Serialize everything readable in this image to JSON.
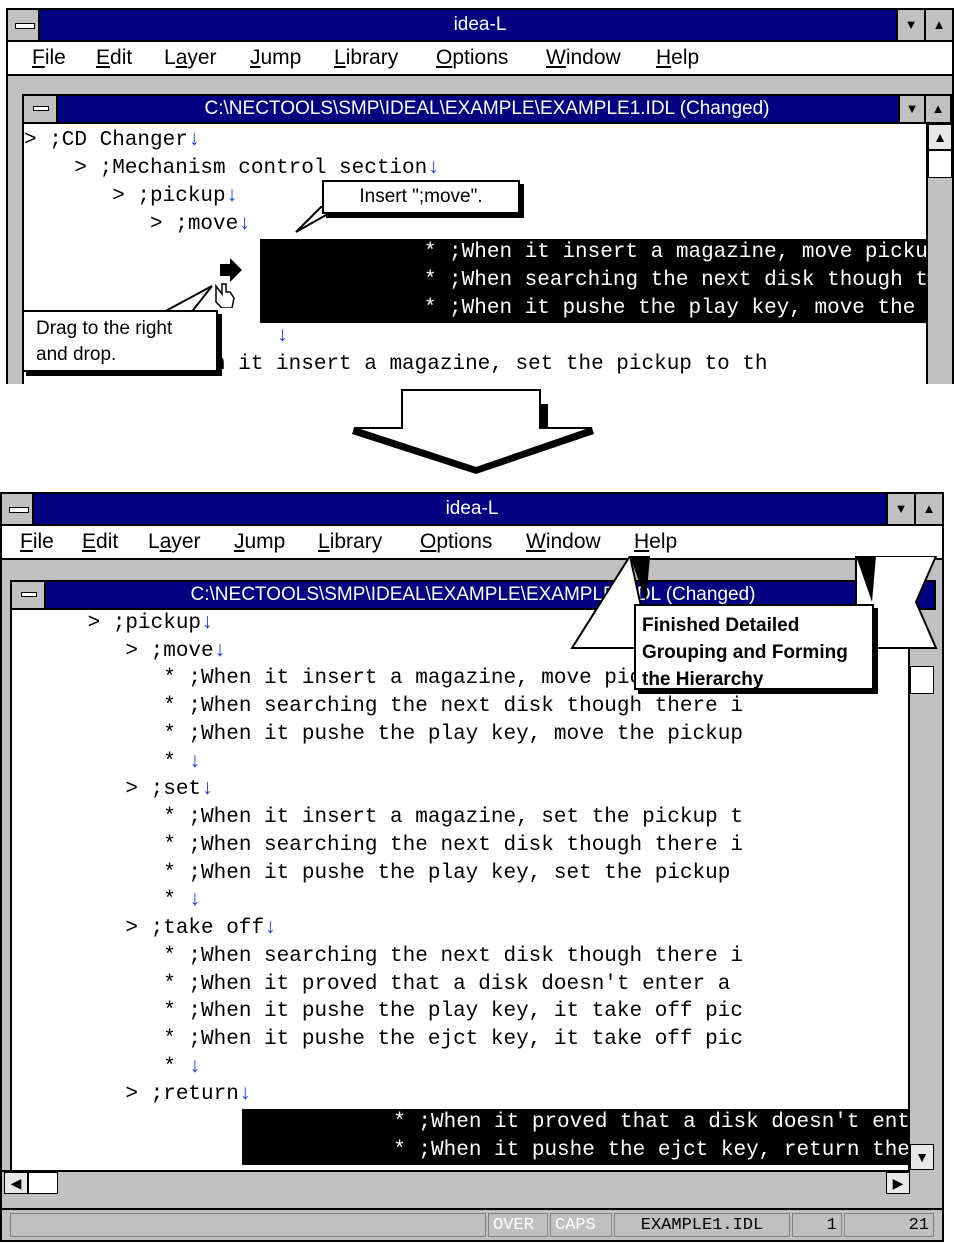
{
  "top": {
    "app_title": "idea-L",
    "menu": [
      "File",
      "Edit",
      "Layer",
      "Jump",
      "Library",
      "Options",
      "Window",
      "Help"
    ],
    "doc_title": "C:\\NECTOOLS\\SMP\\IDEAL\\EXAMPLE\\EXAMPLE1.IDL (Changed)",
    "lines": [
      "> ;CD Changer",
      "    > ;Mechanism control section",
      "       > ;pickup",
      "          > ;move",
      "             * ;When it insert a magazine, move pickup to p",
      "             * ;When searching the next disk though there i",
      "             * ;When it pushe the play key, move the pickup",
      "           ;When it insert a magazine, set the pickup to th"
    ],
    "callout_insert": "Insert \";move\".",
    "callout_drag_1": "Drag to the right",
    "callout_drag_2": "and drop."
  },
  "bottom": {
    "app_title": "idea-L",
    "menu": [
      "File",
      "Edit",
      "Layer",
      "Jump",
      "Library",
      "Options",
      "Window",
      "Help"
    ],
    "doc_title": "C:\\NECTOOLS\\SMP\\IDEAL\\EXAMPLE\\EXAMPLE1.IDL (Changed)",
    "lines": [
      "      > ;pickup",
      "         > ;move",
      "            * ;When it insert a magazine, move pickup to p",
      "            * ;When searching the next disk though there i",
      "            * ;When it pushe the play key, move the pickup",
      "            * ",
      "         > ;set",
      "            * ;When it insert a magazine, set the pickup t",
      "            * ;When searching the next disk though there i",
      "            * ;When it pushe the play key, set the pickup ",
      "            * ",
      "         > ;take off",
      "            * ;When searching the next disk though there i",
      "            * ;When it proved that a disk doesn't enter a ",
      "            * ;When it pushe the play key, it take off pic",
      "            * ;When it pushe the ejct key, it take off pic",
      "            * ",
      "         > ;return",
      "            * ;When it proved that a disk doesn't enter a ",
      "            * ;When it pushe the ejct key, return the pick"
    ],
    "banner": [
      "Finished Detailed",
      "Grouping and Forming",
      "the Hierarchy"
    ],
    "status": {
      "over": "OVER",
      "caps": "CAPS",
      "file": "EXAMPLE1.IDL",
      "line": "1",
      "col": "21"
    }
  }
}
